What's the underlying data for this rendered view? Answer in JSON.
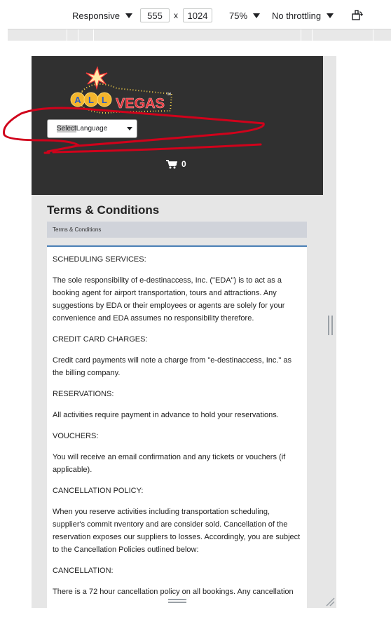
{
  "devtools": {
    "device": "Responsive",
    "width": "555",
    "times": "x",
    "height": "1024",
    "zoom": "75%",
    "throttle": "No throttling"
  },
  "site": {
    "logo_text": "ALL VEGAS",
    "language_select_highlight": "Select",
    "language_select_rest": " Language",
    "cart_count": "0",
    "page_title": "Terms & Conditions",
    "breadcrumb": "Terms & Conditions",
    "content": [
      "SCHEDULING SERVICES:",
      "The sole responsibility of e-destinaccess, Inc. (\"EDA\") is to act as a booking agent for airport transportation, tours and attractions. Any suggestions by EDA or their employees or agents are solely for your convenience and EDA assumes no responsibility therefore.",
      "CREDIT CARD CHARGES:",
      "Credit card payments will note a charge from \"e-destinaccess, Inc.\" as the billing company.",
      "RESERVATIONS:",
      "All activities require payment in advance to hold your reservations.",
      "VOUCHERS:",
      "You will receive an email confirmation and any tickets or vouchers (if applicable).",
      "CANCELLATION POLICY:",
      "When you reserve activities including transportation scheduling, supplier's commit nventory and are consider sold.  Cancellation of the reservation exposes our suppliers to losses. Accordingly, you are subject to the Cancellation Policies outlined below:",
      "CANCELLATION:",
      "There is a 72 hour cancellation policy on all bookings. Any cancellation"
    ]
  },
  "colors": {
    "header_bg": "#303030",
    "annotation": "#d0021b",
    "content_border": "#4a7fb5"
  }
}
